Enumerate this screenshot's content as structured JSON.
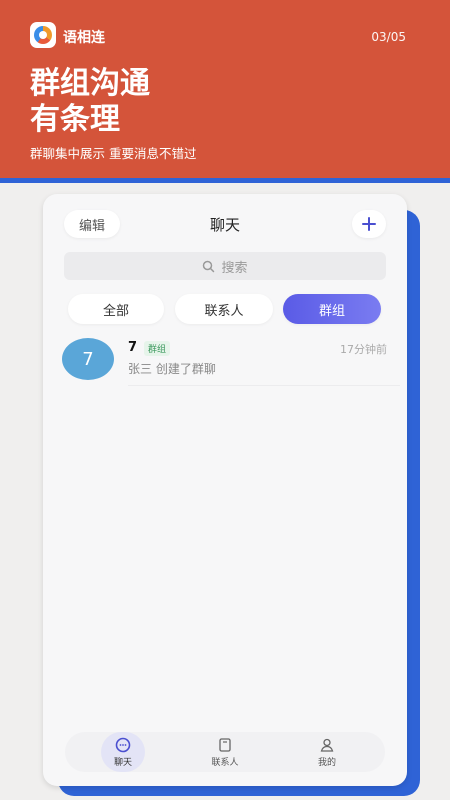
{
  "hero": {
    "app_name": "语相连",
    "page_indicator": "03/05",
    "headline_line1": "群组沟通",
    "headline_line2": "有条理",
    "subtitle": "群聊集中展示 重要消息不错过",
    "colors": {
      "hero_bg": "#d4543a",
      "accent_blue": "#2f63d6"
    }
  },
  "screen": {
    "edit_label": "编辑",
    "title": "聊天",
    "add_icon": "plus-icon",
    "search_placeholder": "搜索",
    "tabs": [
      {
        "label": "全部",
        "active": false
      },
      {
        "label": "联系人",
        "active": false
      },
      {
        "label": "群组",
        "active": true
      }
    ],
    "chats": [
      {
        "avatar_text": "7",
        "name": "7",
        "badge": "群组",
        "time": "17分钟前",
        "preview": "张三 创建了群聊"
      }
    ],
    "nav": [
      {
        "label": "聊天",
        "icon": "chat-icon",
        "active": true
      },
      {
        "label": "联系人",
        "icon": "contacts-icon",
        "active": false
      },
      {
        "label": "我的",
        "icon": "profile-icon",
        "active": false
      }
    ],
    "colors": {
      "tab_active": "#5a5be6",
      "avatar": "#5aa6d8"
    }
  }
}
